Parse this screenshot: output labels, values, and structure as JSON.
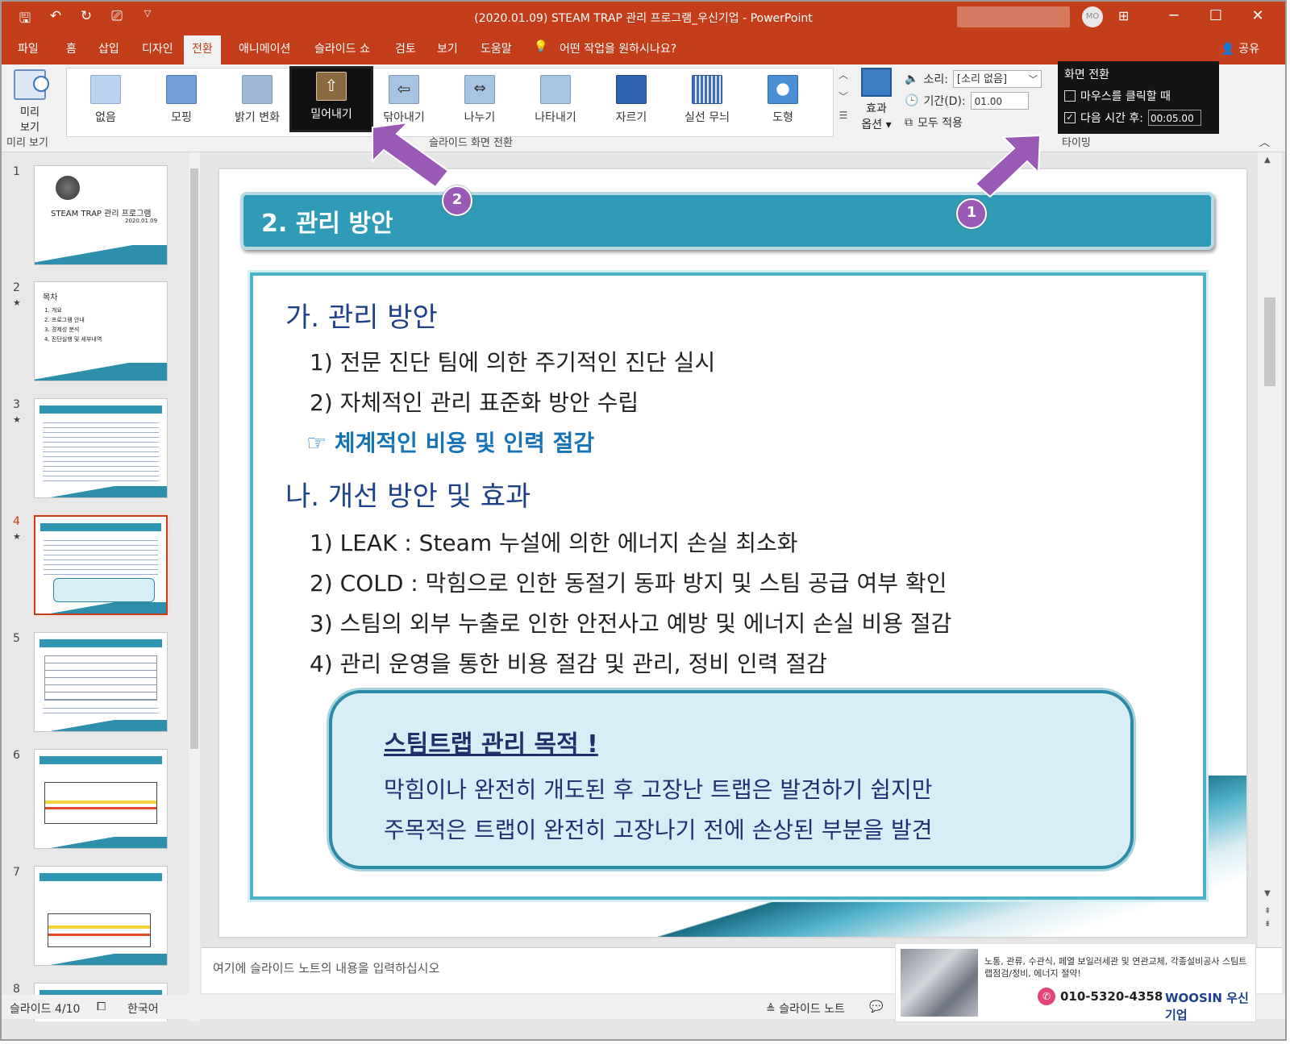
{
  "window": {
    "title": "(2020.01.09) STEAM TRAP 관리 프로그램_우신기업  -  PowerPoint",
    "avatar": "MO",
    "buttons": [
      "─",
      "☐",
      "✕"
    ]
  },
  "tabs": [
    "파일",
    "홈",
    "삽입",
    "디자인",
    "전환",
    "애니메이션",
    "슬라이드 쇼",
    "검토",
    "보기",
    "도움말",
    "어떤 작업을 원하시나요?"
  ],
  "share": "공유",
  "ribbon": {
    "preview": {
      "label": "미리\n보기",
      "group": "미리 보기"
    },
    "transitions": [
      {
        "label": "없음",
        "color": "#b9d3ee"
      },
      {
        "label": "모핑",
        "color": "#6f9fd6"
      },
      {
        "label": "밝기 변화",
        "color": "#9eb8d8"
      },
      {
        "label": "밀어내기",
        "color": "#8a6a3e",
        "selected": true
      },
      {
        "label": "닦아내기",
        "color": "#a8c4e4"
      },
      {
        "label": "나누기",
        "color": "#a8c4e4"
      },
      {
        "label": "나타내기",
        "color": "#a8c4e4"
      },
      {
        "label": "자르기",
        "color": "#2f65b0"
      },
      {
        "label": "실선 무늬",
        "color": "#3f6fb5"
      },
      {
        "label": "도형",
        "color": "#4b8fd6"
      }
    ],
    "transitions_group": "슬라이드 화면 전환",
    "effect_options": "효과\n옵션 ▾",
    "sound_label": "소리:",
    "sound_value": "[소리 없음]",
    "duration_label": "기간(D):",
    "duration_value": "01.00",
    "apply_all": "모두 적용",
    "advance": {
      "title": "화면 전환",
      "on_click": "마우스를 클릭할 때",
      "on_click_checked": false,
      "after": "다음 시간 후:",
      "after_checked": true,
      "after_value": "00:05.00"
    },
    "timing_group": "타이밍"
  },
  "thumbnails": [
    {
      "num": "1",
      "star": false,
      "title": "STEAM TRAP 관리 프로그램",
      "sub": "2020.01.09"
    },
    {
      "num": "2",
      "star": true,
      "title": "목차",
      "items": [
        "1. 개요",
        "2. 프로그램 안내",
        "3. 경제성 분석",
        "4. 진단실행 및 세부내역"
      ]
    },
    {
      "num": "3",
      "star": true
    },
    {
      "num": "4",
      "star": true,
      "current": true
    },
    {
      "num": "5",
      "star": false
    },
    {
      "num": "6",
      "star": false
    },
    {
      "num": "7",
      "star": false
    },
    {
      "num": "8",
      "star": false
    }
  ],
  "slide": {
    "title": "2. 관리 방안",
    "section_a": "가. 관리 방안",
    "a_items": [
      "1) 전문 진단 팀에 의한 주기적인 진단 실시",
      "2) 자체적인 관리 표준화 방안 수립"
    ],
    "a_emphasis": "☞ 체계적인 비용 및 인력 절감",
    "section_b": "나. 개선 방안 및 효과",
    "b_items": [
      "1) LEAK : Steam 누설에 의한 에너지 손실 최소화",
      "2) COLD : 막힘으로 인한 동절기 동파 방지 및 스팀 공급 여부 확인",
      "3) 스팀의 외부 누출로 인한 안전사고 예방 및 에너지 손실 비용 절감",
      "4) 관리 운영을 통한 비용 절감 및 관리, 정비 인력 절감"
    ],
    "callout_title": "스팀트랩 관리 목적 !",
    "callout_lines": [
      "막힘이나 완전히 개도된 후 고장난 트랩은 발견하기 쉽지만",
      "주목적은 트랩이 완전히 고장나기 전에 손상된 부분을 발견"
    ]
  },
  "notes_placeholder": "여기에 슬라이드 노트의 내용을 입력하십시오",
  "status": {
    "slide_pos": "슬라이드 4/10",
    "language": "한국어",
    "notes_btn": "슬라이드 노트"
  },
  "annotations": {
    "badge1": "1",
    "badge2": "2",
    "color": "#9b59b6"
  },
  "ad": {
    "text": "노통, 관류, 수관식, 페열 보일러세관 및 연관교체, 각종설비공사 스팀트랩점검/정비, 에너지 절약!",
    "phone": "010-5320-4358",
    "brand": "WOOSIN 우신기업"
  }
}
